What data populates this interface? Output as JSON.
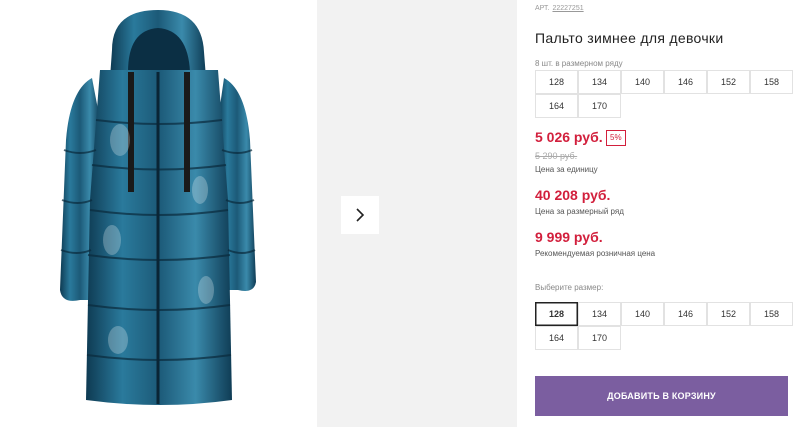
{
  "product": {
    "sku_label": "АРТ.",
    "sku_value": "22227251",
    "title": "Пальто зимнее для девочки"
  },
  "size_range": {
    "label": "8 шт. в размерном ряду",
    "sizes": [
      "128",
      "134",
      "140",
      "146",
      "152",
      "158",
      "164",
      "170"
    ]
  },
  "prices": {
    "unit_price": "5 026 руб.",
    "discount": "5%",
    "old_price": "5 290 руб.",
    "unit_caption": "Цена за единицу",
    "range_price": "40 208 руб.",
    "range_caption": "Цена за размерный ряд",
    "rrp_price": "9 999 руб.",
    "rrp_caption": "Рекомендуемая розничная цена"
  },
  "size_select": {
    "label": "Выберите размер:",
    "selected": "128",
    "sizes": [
      "128",
      "134",
      "140",
      "146",
      "152",
      "158",
      "164",
      "170"
    ]
  },
  "cart": {
    "button_label": "ДОБАВИТЬ В КОРЗИНУ"
  },
  "icons": {
    "next_arrow": "chevron-right-icon"
  },
  "colors": {
    "price_red": "#d21f3c",
    "cart_button": "#7b5ea0",
    "coat": "#1f5a78"
  }
}
